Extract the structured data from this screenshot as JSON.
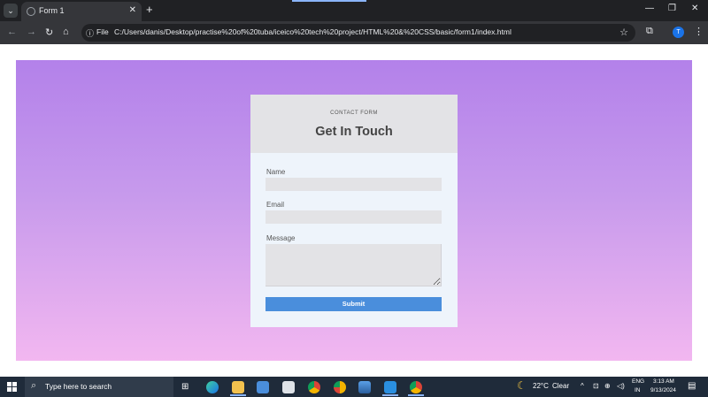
{
  "browser": {
    "tab_title": "Form 1",
    "tab_close": "✕",
    "newtab": "+",
    "address_prefix": "File",
    "url": "C:/Users/danis/Desktop/practise%20of%20tuba/iceico%20tech%20project/HTML%20&%20CSS/basic/form1/index.html",
    "profile_initial": "T"
  },
  "form": {
    "eyebrow": "CONTACT FORM",
    "title": "Get In Touch",
    "name_label": "Name",
    "email_label": "Email",
    "message_label": "Message",
    "submit_label": "Submit"
  },
  "taskbar": {
    "search_placeholder": "Type here to search",
    "weather_temp": "22°C",
    "weather_text": "Clear",
    "lang_top": "ENG",
    "lang_bottom": "IN",
    "time": "3:13 AM",
    "date": "9/13/2024"
  },
  "colors": {
    "gradient_top": "#b381ea",
    "gradient_bottom": "#f2b7f0",
    "card_bg": "#eef4fb",
    "header_bg": "#e3e3e6",
    "button_bg": "#4a8edc"
  }
}
